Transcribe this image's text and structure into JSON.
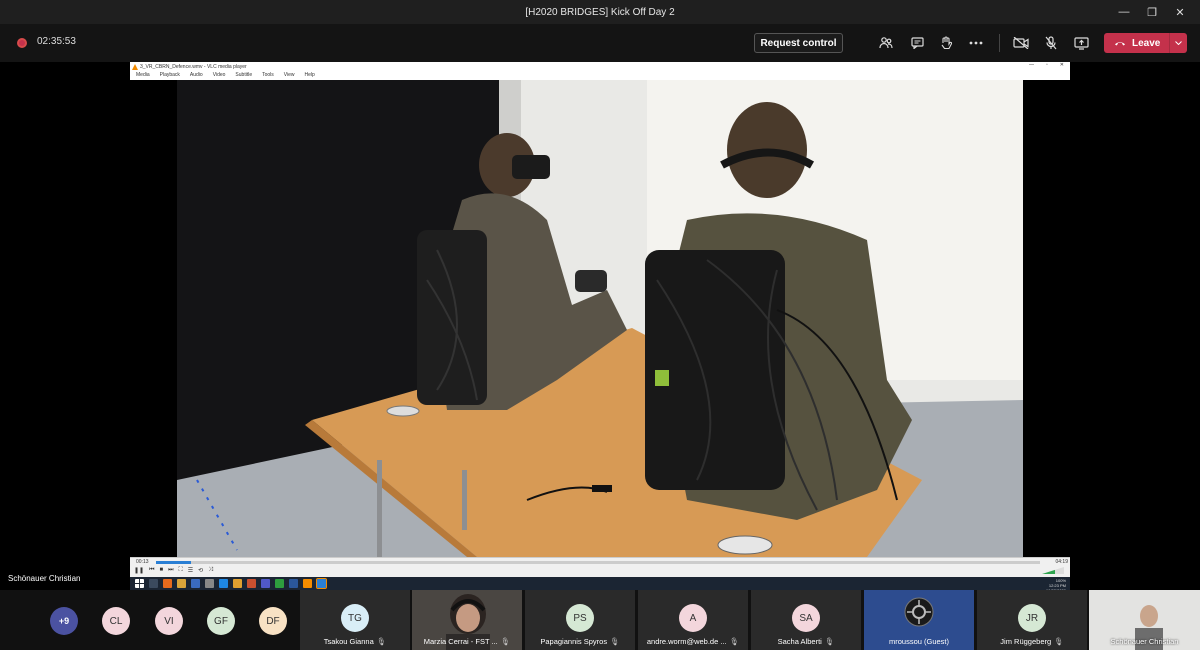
{
  "window": {
    "title": "[H2020 BRIDGES] Kick Off Day 2",
    "controls": [
      "—",
      "❐",
      "✕"
    ]
  },
  "toolbar": {
    "timer": "02:35:53",
    "request_control_label": "Request control",
    "leave_label": "Leave",
    "icons": [
      "participants-icon",
      "chat-icon",
      "raise-hand-icon",
      "more-icon",
      "camera-off-icon",
      "mic-off-icon",
      "share-icon"
    ]
  },
  "vlc": {
    "title": "3_VR_CBRN_Defence.wmv - VLC media player",
    "menu": [
      "Media",
      "Playback",
      "Audio",
      "Video",
      "Subtitle",
      "Tools",
      "View",
      "Help"
    ],
    "time_elapsed": "00:13",
    "time_total": "04:19",
    "progress": 0.04,
    "volume": "100%",
    "clock_time": "12:23 PM",
    "clock_date": "10/22/2020"
  },
  "presenter_name": "Schönauer Christian",
  "participants": {
    "overflow": "+9",
    "avatars": [
      {
        "initials": "CL",
        "color": "#f3d6dc"
      },
      {
        "initials": "VI",
        "color": "#f3d6dc"
      },
      {
        "initials": "GF",
        "color": "#d5e8d4"
      },
      {
        "initials": "DF",
        "color": "#f8e2c4"
      }
    ],
    "tiles": [
      {
        "name": "Tsakou Gianna",
        "initials": "TG",
        "color": "#d9eef7"
      },
      {
        "name": "Marzia Cerrai - FST ...",
        "initials": "",
        "color": "#3a3a3a"
      },
      {
        "name": "Papagiannis Spyros",
        "initials": "PS",
        "color": "#d5e8d4"
      },
      {
        "name": "andre.worm@web.de ...",
        "initials": "A",
        "color": "#f3d6dc"
      },
      {
        "name": "Sacha Alberti",
        "initials": "SA",
        "color": "#f3d6dc"
      },
      {
        "name": "mroussou (Guest)",
        "initials": "",
        "color": "#2d4c8f"
      },
      {
        "name": "Jim Rüggeberg",
        "initials": "JR",
        "color": "#d5e8d4"
      },
      {
        "name": "Schönauer Christian",
        "initials": "",
        "color": "#d8d8d8"
      }
    ]
  }
}
